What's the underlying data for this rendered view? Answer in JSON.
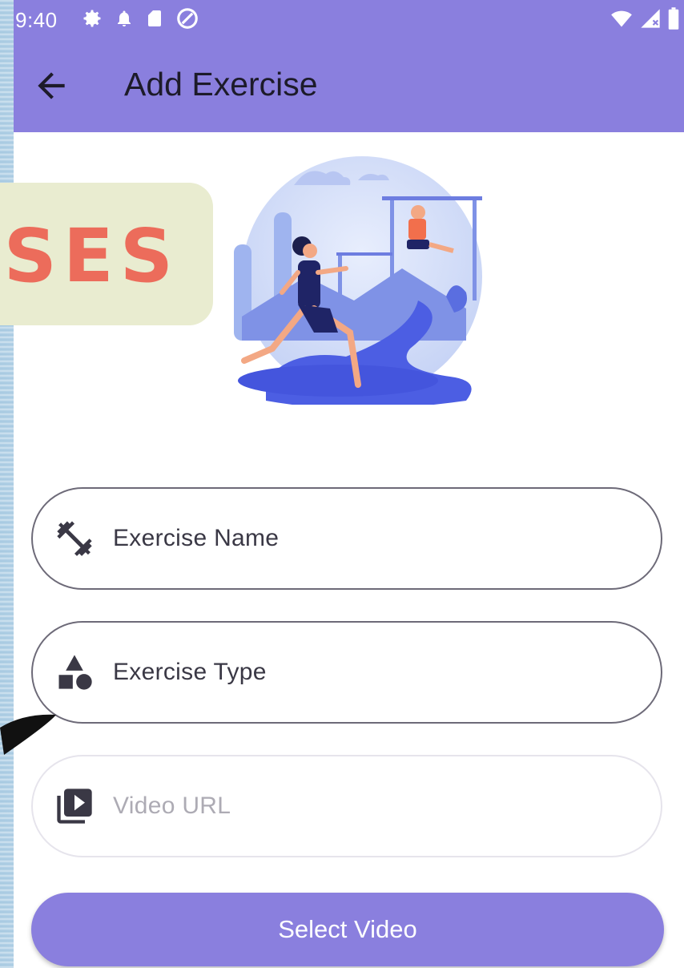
{
  "status_bar": {
    "time": "9:40",
    "left_icons": [
      "gear-icon",
      "notification-bell-icon",
      "sd-card-icon",
      "at-sign-icon"
    ],
    "right_icons": [
      "wifi-icon",
      "signal-icon",
      "battery-icon"
    ]
  },
  "appbar": {
    "title": "Add Exercise",
    "back_icon": "arrow-back-icon",
    "color": "#8a7fde"
  },
  "form": {
    "exercise_name": {
      "placeholder": "Exercise Name",
      "icon": "fitness-dumbbell-icon"
    },
    "exercise_type": {
      "placeholder": "Exercise Type",
      "icon": "category-shapes-icon"
    },
    "video_url": {
      "placeholder": "Video URL",
      "icon": "video-library-icon",
      "enabled": false
    }
  },
  "select_video_button": {
    "label": "Select Video"
  },
  "overlay": {
    "banner_text": "ISES",
    "banner_color": "#e9ecd0",
    "text_color": "#ec6c5b"
  }
}
